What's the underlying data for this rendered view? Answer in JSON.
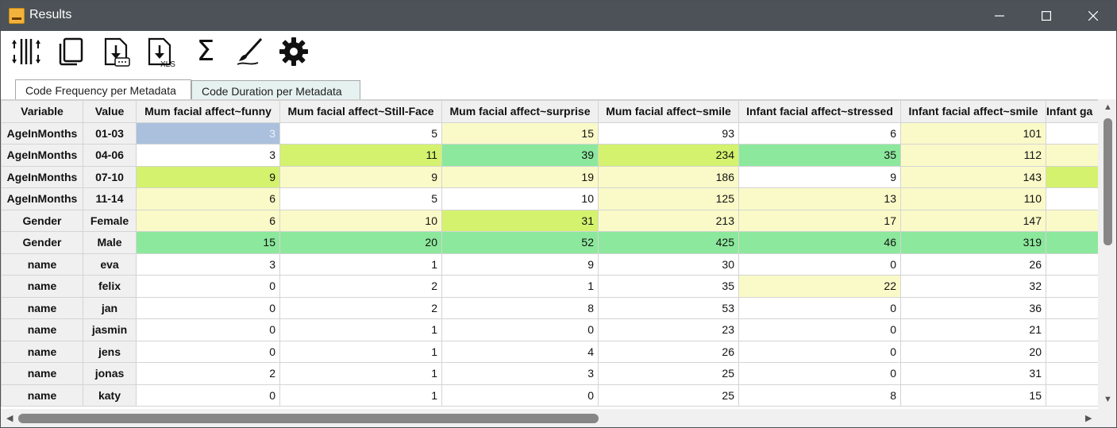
{
  "window": {
    "title": "Results"
  },
  "toolbar": {
    "icons": [
      "columns-adjust-icon",
      "copy-icon",
      "export-icon",
      "export-xls-icon",
      "sum-icon",
      "brush-icon",
      "settings-icon"
    ],
    "xls_label": "XLS",
    "sum_glyph": "Σ"
  },
  "tabs": [
    {
      "label": "Code Frequency per Metadata",
      "active": true
    },
    {
      "label": "Code Duration per Metadata",
      "active": false
    }
  ],
  "colors": {
    "blue": "#aac0dc",
    "yellow": "#fafac8",
    "lime": "#d4f26e",
    "green": "#8ce89c"
  },
  "table": {
    "columns": [
      "Variable",
      "Value",
      "Mum facial affect~funny",
      "Mum facial affect~Still-Face",
      "Mum facial affect~surprise",
      "Mum facial affect~smile",
      "Infant facial affect~stressed",
      "Infant facial affect~smile",
      "Infant ga"
    ],
    "rows": [
      {
        "variable": "AgeInMonths",
        "value": "01-03",
        "cells": [
          "3",
          "5",
          "15",
          "93",
          "6",
          "101",
          ""
        ],
        "shade": [
          "blue",
          "white",
          "yellow",
          "white",
          "white",
          "yellow",
          "white"
        ]
      },
      {
        "variable": "AgeInMonths",
        "value": "04-06",
        "cells": [
          "3",
          "11",
          "39",
          "234",
          "35",
          "112",
          ""
        ],
        "shade": [
          "white",
          "lime",
          "green",
          "lime",
          "green",
          "yellow",
          "yellow"
        ]
      },
      {
        "variable": "AgeInMonths",
        "value": "07-10",
        "cells": [
          "9",
          "9",
          "19",
          "186",
          "9",
          "143",
          ""
        ],
        "shade": [
          "lime",
          "yellow",
          "yellow",
          "yellow",
          "white",
          "yellow",
          "lime"
        ]
      },
      {
        "variable": "AgeInMonths",
        "value": "11-14",
        "cells": [
          "6",
          "5",
          "10",
          "125",
          "13",
          "110",
          ""
        ],
        "shade": [
          "yellow",
          "white",
          "white",
          "yellow",
          "yellow",
          "yellow",
          "white"
        ]
      },
      {
        "variable": "Gender",
        "value": "Female",
        "cells": [
          "6",
          "10",
          "31",
          "213",
          "17",
          "147",
          ""
        ],
        "shade": [
          "yellow",
          "yellow",
          "lime",
          "yellow",
          "yellow",
          "yellow",
          "yellow"
        ]
      },
      {
        "variable": "Gender",
        "value": "Male",
        "cells": [
          "15",
          "20",
          "52",
          "425",
          "46",
          "319",
          ""
        ],
        "shade": [
          "green",
          "green",
          "green",
          "green",
          "green",
          "green",
          "green"
        ]
      },
      {
        "variable": "name",
        "value": "eva",
        "cells": [
          "3",
          "1",
          "9",
          "30",
          "0",
          "26",
          ""
        ],
        "shade": [
          "white",
          "white",
          "white",
          "white",
          "white",
          "white",
          "white"
        ]
      },
      {
        "variable": "name",
        "value": "felix",
        "cells": [
          "0",
          "2",
          "1",
          "35",
          "22",
          "32",
          ""
        ],
        "shade": [
          "white",
          "white",
          "white",
          "white",
          "yellow",
          "white",
          "white"
        ]
      },
      {
        "variable": "name",
        "value": "jan",
        "cells": [
          "0",
          "2",
          "8",
          "53",
          "0",
          "36",
          ""
        ],
        "shade": [
          "white",
          "white",
          "white",
          "white",
          "white",
          "white",
          "white"
        ]
      },
      {
        "variable": "name",
        "value": "jasmin",
        "cells": [
          "0",
          "1",
          "0",
          "23",
          "0",
          "21",
          ""
        ],
        "shade": [
          "white",
          "white",
          "white",
          "white",
          "white",
          "white",
          "white"
        ]
      },
      {
        "variable": "name",
        "value": "jens",
        "cells": [
          "0",
          "1",
          "4",
          "26",
          "0",
          "20",
          ""
        ],
        "shade": [
          "white",
          "white",
          "white",
          "white",
          "white",
          "white",
          "white"
        ]
      },
      {
        "variable": "name",
        "value": "jonas",
        "cells": [
          "2",
          "1",
          "3",
          "25",
          "0",
          "31",
          ""
        ],
        "shade": [
          "white",
          "white",
          "white",
          "white",
          "white",
          "white",
          "white"
        ]
      },
      {
        "variable": "name",
        "value": "katy",
        "cells": [
          "0",
          "1",
          "0",
          "25",
          "8",
          "15",
          ""
        ],
        "shade": [
          "white",
          "white",
          "white",
          "white",
          "white",
          "white",
          "white"
        ]
      }
    ]
  }
}
